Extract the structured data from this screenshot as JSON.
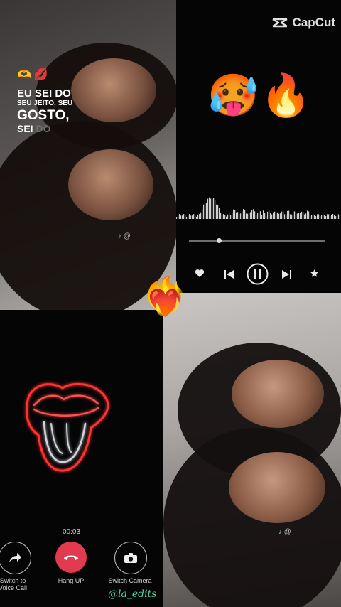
{
  "lyrics": {
    "emoji": "🫶💋",
    "line1": "EU SEI DO",
    "line2": "SEU JEITO, SEU",
    "line3": "GOSTO,",
    "line4_bright": "SEI ",
    "line4_dim": "DO"
  },
  "brand": {
    "name": "CapCut"
  },
  "player": {
    "emoji": "🥵🔥",
    "progress": 0.22
  },
  "center_emoji": "❤️‍🔥",
  "call": {
    "timer": "00:03",
    "voice_label_1": "Switch to",
    "voice_label_2": "Voice Call",
    "hangup_label": "Hang UP",
    "camera_label": "Switch Camera"
  },
  "tiktok_marks": {
    "top": "♪ @",
    "bottom": "♪ @"
  },
  "watermark": "@la_edits",
  "colors": {
    "hangup": "#e23a4e",
    "watermark": "#4fd3a5",
    "neon": "#ff3a3a"
  }
}
